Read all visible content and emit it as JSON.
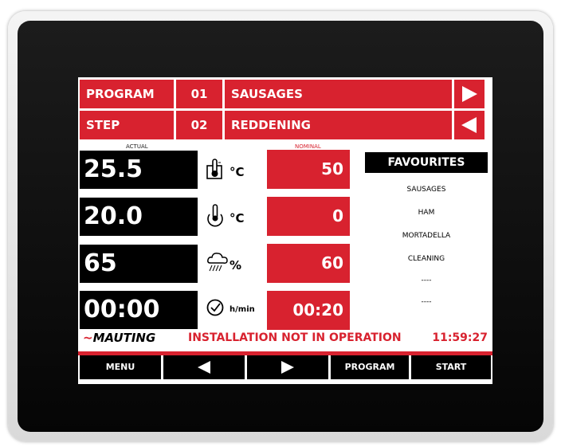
{
  "header": {
    "program_label": "PROGRAM",
    "program_number": "01",
    "program_name": "SAUSAGES",
    "step_label": "STEP",
    "step_number": "02",
    "step_name": "REDDENING"
  },
  "labels": {
    "actual": "ACTUAL",
    "nominal": "NOMINAL"
  },
  "rows": [
    {
      "actual": "25.5",
      "icon": "thermometer-chamber-icon",
      "unit": "°C",
      "nominal": "50"
    },
    {
      "actual": "20.0",
      "icon": "core-thermometer-icon",
      "unit": "°C",
      "nominal": "0"
    },
    {
      "actual": "65",
      "icon": "humidity-cloud-icon",
      "unit": "%",
      "nominal": "60"
    },
    {
      "actual": "00:00",
      "icon": "timer-icon",
      "unit": "h/min",
      "nominal": "00:20"
    }
  ],
  "favourites": {
    "title": "FAVOURITES",
    "items": [
      "SAUSAGES",
      "HAM",
      "MORTADELLA",
      "CLEANING",
      "----",
      "----"
    ]
  },
  "status": {
    "brand": "MAUTING",
    "message": "INSTALLATION NOT IN OPERATION",
    "clock": "11:59:27"
  },
  "footer": {
    "menu": "MENU",
    "program": "PROGRAM",
    "start": "START"
  },
  "colors": {
    "accent": "#d8222f",
    "dark": "#000000"
  }
}
